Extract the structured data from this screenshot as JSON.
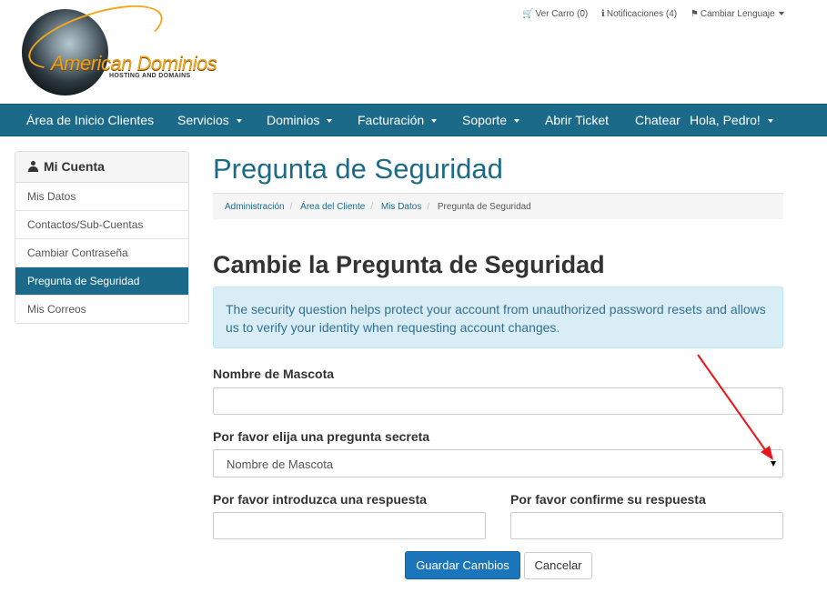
{
  "header": {
    "brand": "American Dominios",
    "tagline": "HOSTING AND DOMAINS",
    "top_links": {
      "cart": "Ver Carro (0)",
      "notifications": "Notificaciones (4)",
      "language": "Cambiar Lenguaje"
    }
  },
  "nav": {
    "home": "Área de Inicio Clientes",
    "services": "Servicios",
    "domains": "Dominios",
    "billing": "Facturación",
    "support": "Soporte",
    "ticket": "Abrir Ticket",
    "chat": "Chatear",
    "user": "Hola, Pedro!"
  },
  "sidebar": {
    "title": "Mi Cuenta",
    "items": [
      {
        "label": "Mis Datos"
      },
      {
        "label": "Contactos/Sub-Cuentas"
      },
      {
        "label": "Cambiar Contraseña"
      },
      {
        "label": "Pregunta de Seguridad"
      },
      {
        "label": "Mis Correos"
      }
    ],
    "active_index": 3
  },
  "page": {
    "title": "Pregunta de Seguridad",
    "breadcrumb": [
      "Administración",
      "Área del Cliente",
      "Mis Datos",
      "Pregunta de Seguridad"
    ],
    "heading": "Cambie la Pregunta de Seguridad",
    "alert": "The security question helps protect your account from unauthorized password resets and allows us to verify your identity when requesting account changes."
  },
  "form": {
    "current_question_label": "Nombre de Mascota",
    "current_answer_value": "",
    "question_label": "Por favor elija una pregunta secreta",
    "question_selected": "Nombre de Mascota",
    "answer_label": "Por favor introduzca una respuesta",
    "confirm_label": "Por favor confirme su respuesta",
    "save_label": "Guardar Cambios",
    "cancel_label": "Cancelar"
  },
  "colors": {
    "primary": "#1c6a8a",
    "button": "#1a75bb",
    "alert_bg": "#d9edf7",
    "annotation": "#e8171b"
  }
}
